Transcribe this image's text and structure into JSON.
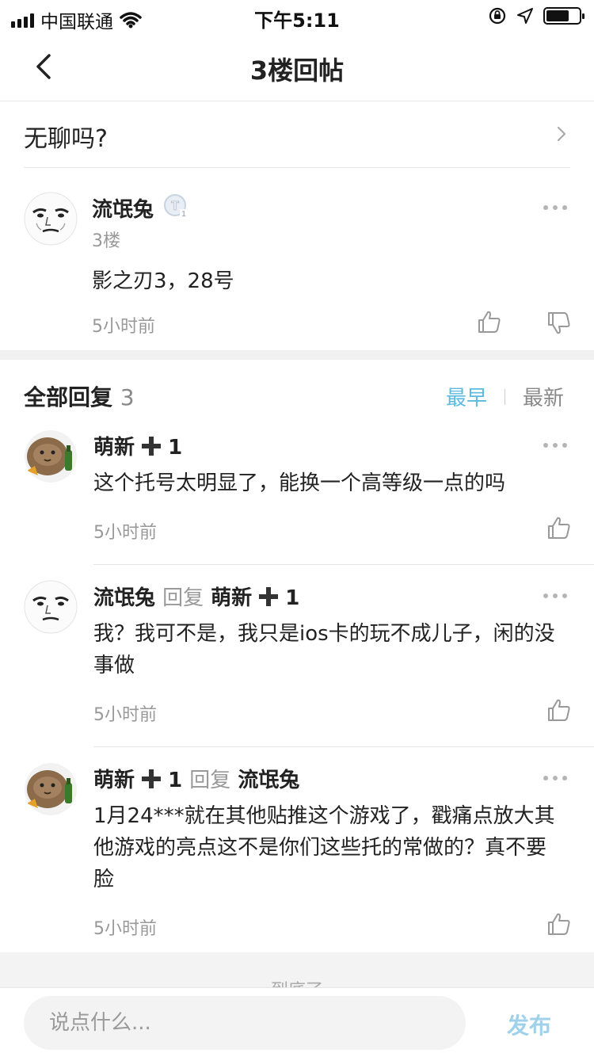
{
  "status_bar": {
    "carrier": "中国联通",
    "time": "下午5:11"
  },
  "nav": {
    "title": "3楼回帖",
    "back_icon": "chevron-left-icon"
  },
  "topic": {
    "title": "无聊吗?"
  },
  "floor_post": {
    "author": "流氓兔",
    "badge_icon": "level-badge-icon",
    "floor": "3楼",
    "content": "影之刃3，28号",
    "time": "5小时前"
  },
  "replies_header": {
    "label": "全部回复",
    "count": "3",
    "sort_earliest": "最早",
    "sort_latest": "最新"
  },
  "replies": [
    {
      "author": "萌新",
      "author_suffix": "1",
      "reply_word": "",
      "reply_to": "",
      "content": "这个托号太明显了，能换一个高等级一点的吗",
      "time": "5小时前"
    },
    {
      "author": "流氓兔",
      "author_suffix": "",
      "reply_word": "回复",
      "reply_to": "萌新",
      "reply_to_suffix": "1",
      "content": "我？我可不是，我只是ios卡的玩不成儿子，闲的没事做",
      "time": "5小时前"
    },
    {
      "author": "萌新",
      "author_suffix": "1",
      "reply_word": "回复",
      "reply_to": "流氓兔",
      "content": "1月24***就在其他贴推这个游戏了，戳痛点放大其他游戏的亮点这不是你们这些托的常做的？真不要脸",
      "time": "5小时前"
    }
  ],
  "footer": {
    "end_text": "到底了"
  },
  "bottom_bar": {
    "input_placeholder": "说点什么...",
    "publish_label": "发布"
  },
  "colors": {
    "accent": "#5bbae0",
    "publish": "#9fd1ea",
    "muted": "#999999",
    "band": "#f1f1f1"
  }
}
